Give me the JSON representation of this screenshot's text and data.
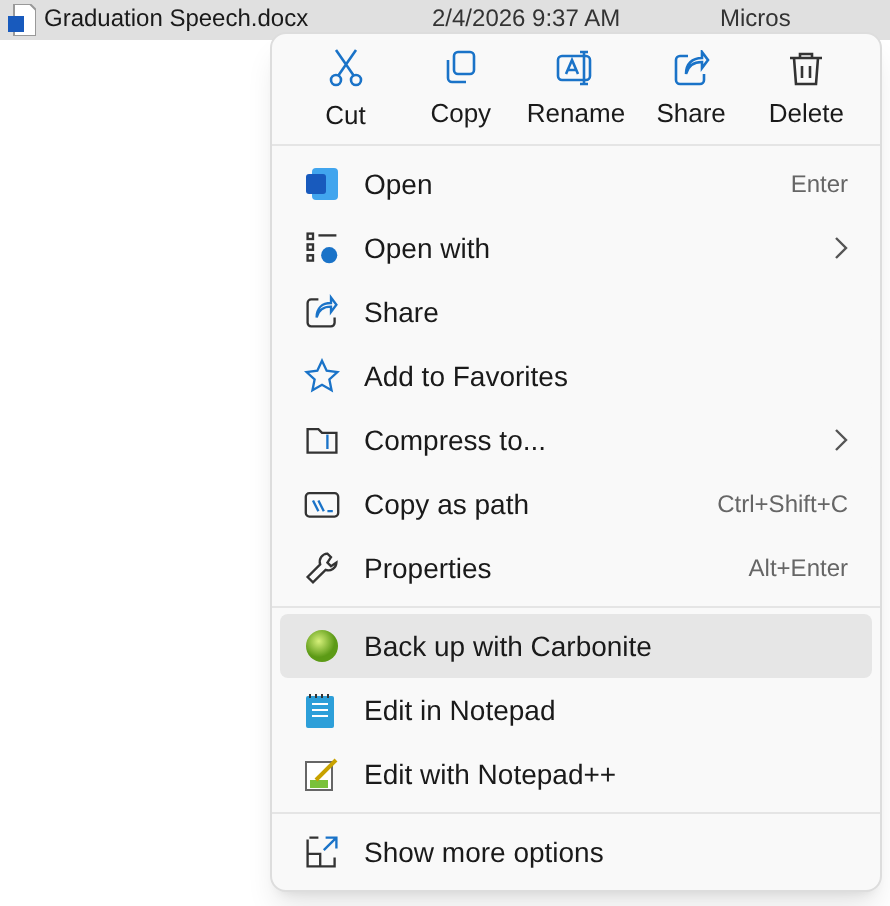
{
  "file_row": {
    "name": "Graduation Speech.docx",
    "date": "2/4/2026 9:37 AM",
    "column_3": "Micros"
  },
  "context_menu": {
    "actions": [
      {
        "label": "Cut"
      },
      {
        "label": "Copy"
      },
      {
        "label": "Rename"
      },
      {
        "label": "Share"
      },
      {
        "label": "Delete"
      }
    ],
    "groups": [
      [
        {
          "label": "Open",
          "shortcut": "Enter",
          "submenu": false,
          "selected": false
        },
        {
          "label": "Open with",
          "submenu": true,
          "selected": false
        },
        {
          "label": "Share",
          "submenu": false,
          "selected": false
        },
        {
          "label": "Add to Favorites",
          "submenu": false,
          "selected": false
        },
        {
          "label": "Compress to...",
          "submenu": true,
          "selected": false
        },
        {
          "label": "Copy as path",
          "shortcut": "Ctrl+Shift+C",
          "submenu": false,
          "selected": false
        },
        {
          "label": "Properties",
          "shortcut": "Alt+Enter",
          "submenu": false,
          "selected": false
        }
      ],
      [
        {
          "label": "Back up with Carbonite",
          "submenu": false,
          "selected": true
        },
        {
          "label": "Edit in Notepad",
          "submenu": false,
          "selected": false
        },
        {
          "label": "Edit with Notepad++",
          "submenu": false,
          "selected": false
        }
      ],
      [
        {
          "label": "Show more options",
          "submenu": false,
          "selected": false
        }
      ]
    ]
  }
}
